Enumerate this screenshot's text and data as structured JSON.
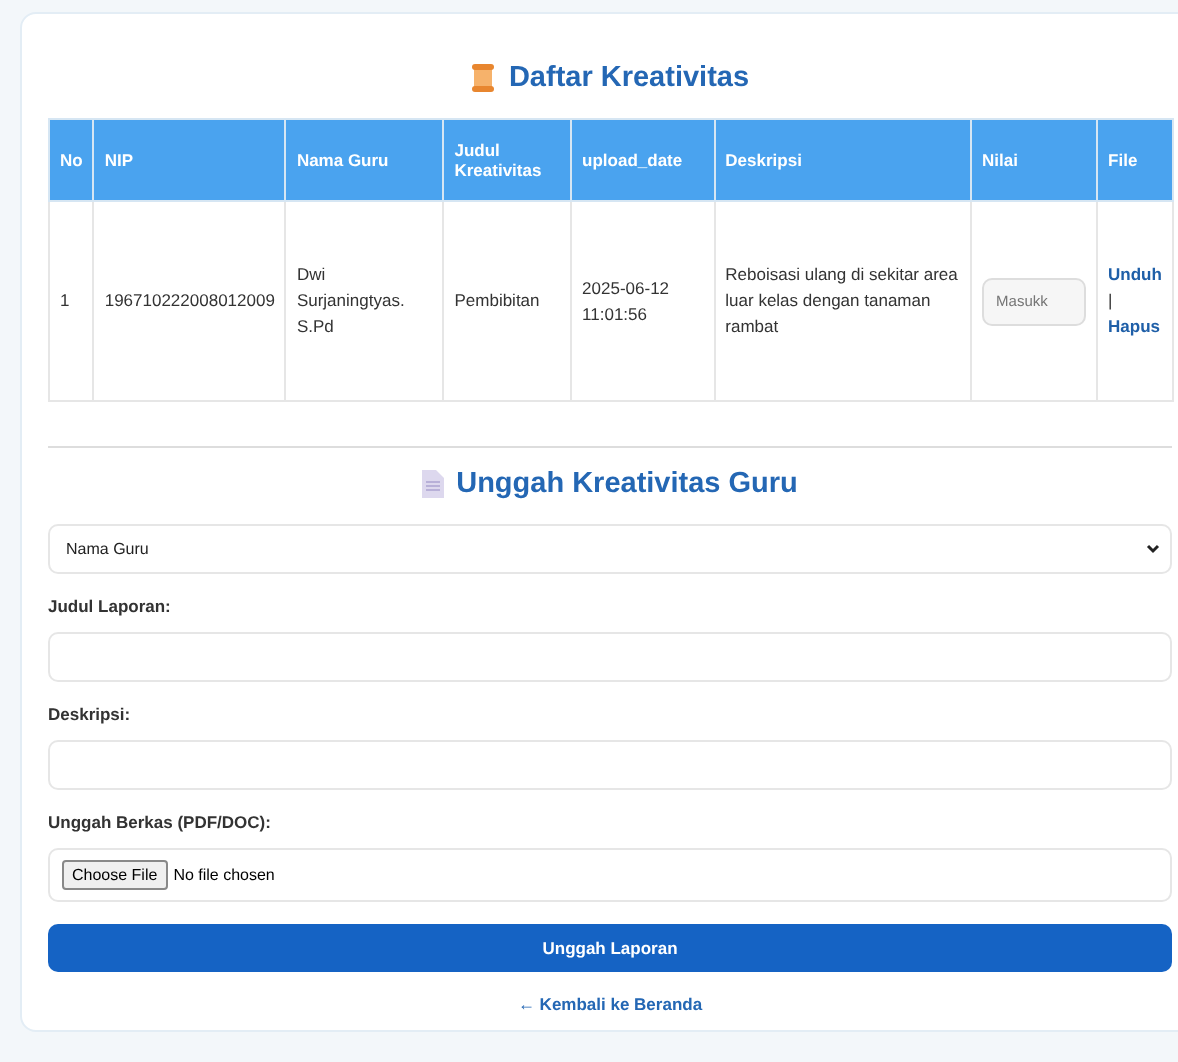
{
  "list_section": {
    "title": "Daftar Kreativitas",
    "table": {
      "columns": [
        "No",
        "NIP",
        "Nama Guru",
        "Judul Kreativitas",
        "upload_date",
        "Deskripsi",
        "Nilai",
        "File"
      ],
      "rows": [
        {
          "no": "1",
          "nip": "196710222008012009",
          "nama_guru": "Dwi Surjaningtyas. S.Pd",
          "judul": "Pembibitan",
          "upload_date": "2025-06-12 11:01:56",
          "deskripsi": "Reboisasi ulang di sekitar area luar kelas dengan tanaman rambat",
          "nilai": {
            "placeholder": "Masukk"
          },
          "file_links": [
            "Unduh",
            "|",
            "Hapus"
          ]
        }
      ]
    }
  },
  "upload_form": {
    "title": "Unggah Kreativitas Guru",
    "teacher_select": {
      "value": "Nama Guru"
    },
    "fields": [
      {
        "label": "Judul Laporan:",
        "kind": "text"
      },
      {
        "label": "Deskripsi:",
        "kind": "text"
      },
      {
        "label": "Unggah Berkas (PDF/DOC):",
        "kind": "file",
        "button": "Choose File",
        "status": "No file chosen"
      }
    ],
    "submit": "Unggah Laporan",
    "back_link": "← Kembali ke Beranda"
  }
}
